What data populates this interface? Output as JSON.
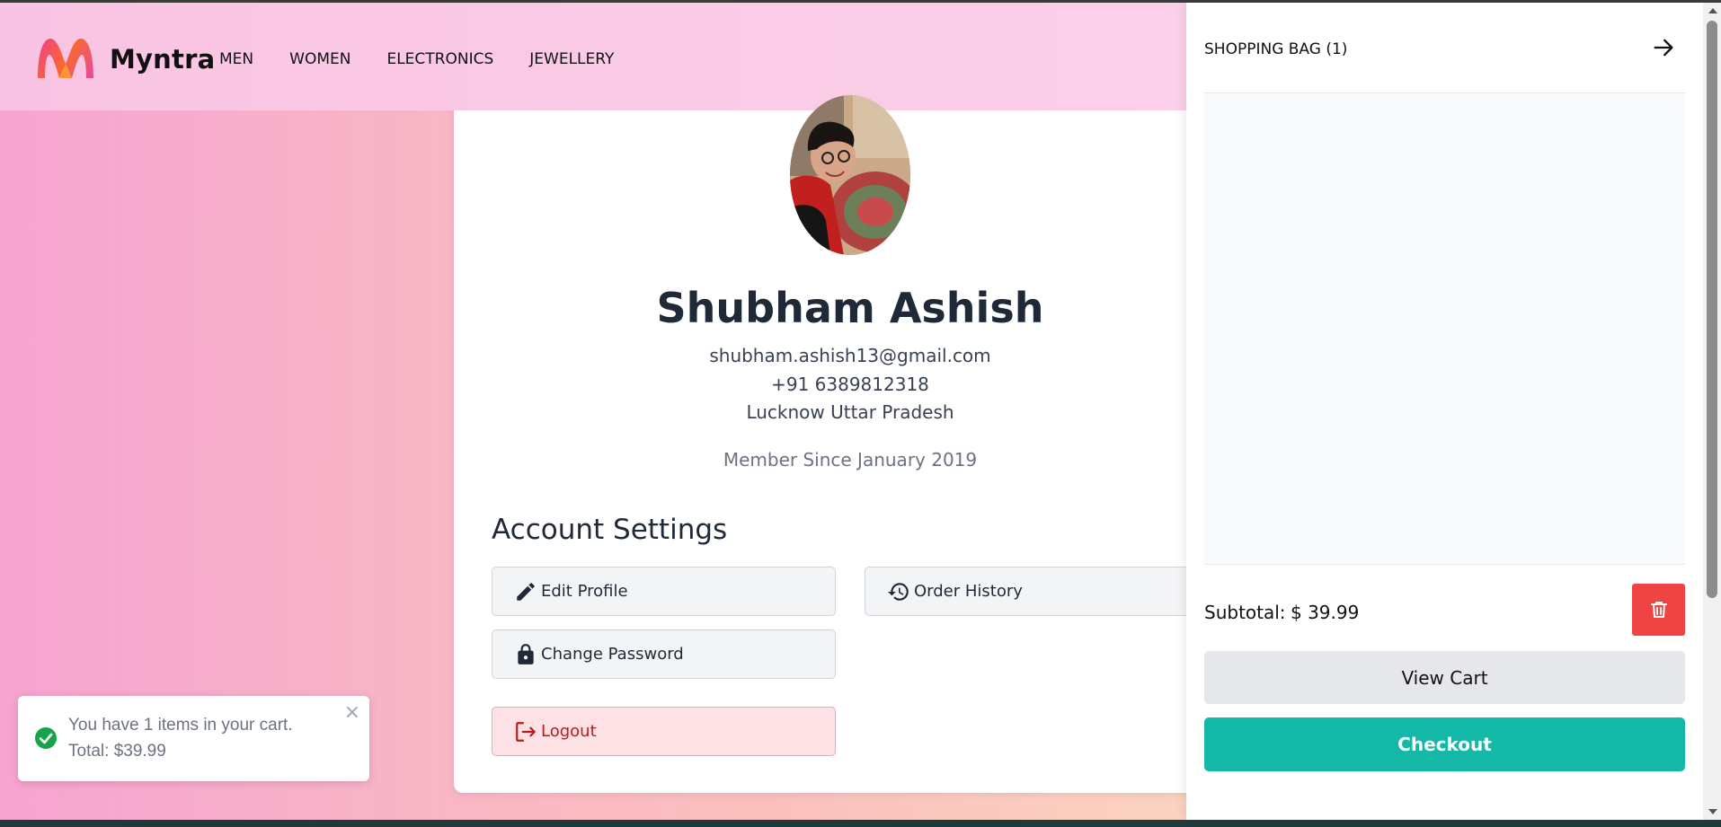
{
  "header": {
    "brand": "Myntra",
    "nav": [
      "MEN",
      "WOMEN",
      "ELECTRONICS",
      "JEWELLERY"
    ]
  },
  "profile": {
    "name": "Shubham Ashish",
    "email": "shubham.ashish13@gmail.com",
    "phone": "+91 6389812318",
    "location": "Lucknow Uttar Pradesh",
    "member_since": "Member Since January 2019"
  },
  "settings": {
    "title": "Account Settings",
    "edit_profile": "Edit Profile",
    "order_history": "Order History",
    "change_password": "Change Password",
    "logout": "Logout"
  },
  "toast": {
    "line1": "You have 1 items in your cart.",
    "line2": "Total: $39.99",
    "close": "×"
  },
  "cart": {
    "title": "SHOPPING BAG (1)",
    "subtotal_label": "Subtotal:",
    "subtotal_value": "$ 39.99",
    "view_cart": "View Cart",
    "checkout": "Checkout"
  },
  "colors": {
    "accent_teal": "#14b8a6",
    "danger_red": "#ef4444",
    "logout_bg": "#fde1e4"
  },
  "icons": [
    "myntra-logo",
    "pencil-icon",
    "history-icon",
    "lock-icon",
    "logout-icon",
    "check-circle-icon",
    "close-icon",
    "arrow-right-icon",
    "trash-icon"
  ]
}
